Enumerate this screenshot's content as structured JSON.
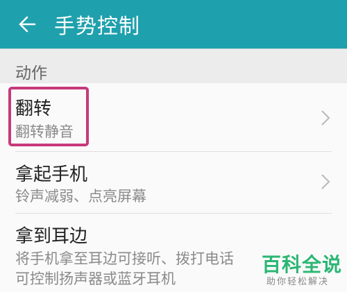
{
  "app_bar": {
    "title": "手势控制",
    "back_icon": "arrow-left-icon",
    "color": "#1fa0ad"
  },
  "section": {
    "header": "动作"
  },
  "items": [
    {
      "label": "翻转",
      "subtitle": "翻转静音"
    },
    {
      "label": "拿起手机",
      "subtitle": "铃声减弱、点亮屏幕"
    },
    {
      "label": "拿到耳边",
      "subtitle_line1": "将手机拿至耳边可接听、拨打电话",
      "subtitle_line2": "可控制扬声器或蓝牙耳机"
    }
  ],
  "highlight_color": "#c8397a",
  "watermark": {
    "title": "百科全说",
    "subtitle": "助你轻松解决",
    "color": "#2bb673"
  }
}
